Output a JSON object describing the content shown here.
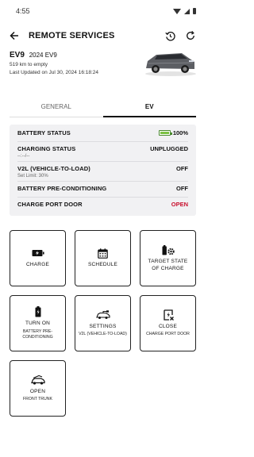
{
  "status_bar": {
    "time": "4:55"
  },
  "header": {
    "title": "REMOTE SERVICES"
  },
  "vehicle": {
    "model": "EV9",
    "year_model": "2024 EV9",
    "range": "519 km to empty",
    "last_updated": "Last Updated on Jul 30, 2024 16:18:24"
  },
  "tabs": [
    {
      "label": "GENERAL",
      "active": false
    },
    {
      "label": "EV",
      "active": true
    }
  ],
  "status": {
    "battery_label": "BATTERY STATUS",
    "battery_value": "100%",
    "battery_level": 1.0,
    "charging_label": "CHARGING STATUS",
    "charging_value": "UNPLUGGED",
    "charging_sub": "--:--/--",
    "v2l_label": "V2L (VEHICLE-TO-LOAD)",
    "v2l_value": "OFF",
    "v2l_sub": "Set Limit: 30%",
    "precond_label": "BATTERY PRE-CONDITIONING",
    "precond_value": "OFF",
    "port_label": "CHARGE PORT DOOR",
    "port_value": "OPEN"
  },
  "colors": {
    "accent_red": "#c8102e",
    "battery_green": "#7cc243"
  },
  "tiles": {
    "charge": {
      "line1": "CHARGE",
      "icon": "battery-bolt-icon"
    },
    "schedule": {
      "line1": "SCHEDULE",
      "icon": "calendar-icon"
    },
    "target": {
      "line1": "TARGET STATE OF CHARGE",
      "icon": "battery-gear-icon"
    },
    "turn_on": {
      "line1": "TURN ON",
      "line2": "BATTERY PRE-CONDITIONING",
      "icon": "battery-icon"
    },
    "settings": {
      "line1": "SETTINGS",
      "line2": "V2L (VEHICLE-TO-LOAD)",
      "icon": "v2l-plug-icon"
    },
    "close": {
      "line1": "CLOSE",
      "line2": "CHARGE PORT DOOR",
      "icon": "charge-port-icon"
    },
    "open": {
      "line1": "OPEN",
      "line2": "FRONT TRUNK",
      "icon": "frunk-icon"
    }
  }
}
